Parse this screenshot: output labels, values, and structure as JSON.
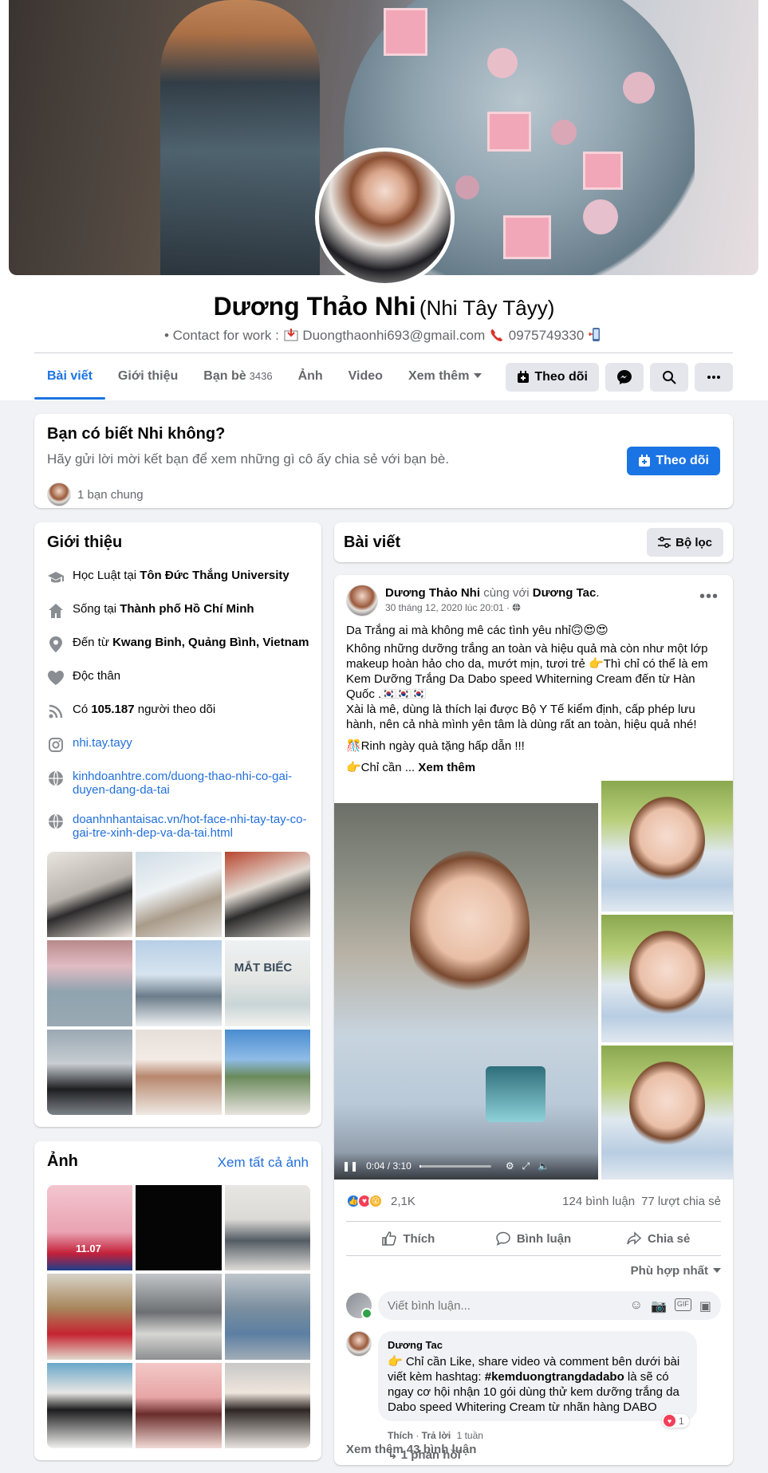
{
  "profile": {
    "name": "Dương Thảo Nhi",
    "alt_name": "(Nhi Tây Tâyy)",
    "contact_prefix": "• Contact for work :",
    "email": "Duongthaonhi693@gmail.com",
    "phone": "0975749330"
  },
  "tabs": [
    {
      "label": "Bài viết"
    },
    {
      "label": "Giới thiệu"
    },
    {
      "label": "Bạn bè",
      "count": "3436"
    },
    {
      "label": "Ảnh"
    },
    {
      "label": "Video"
    },
    {
      "label": "Xem thêm"
    }
  ],
  "actions": {
    "follow": "Theo dõi"
  },
  "know": {
    "title": "Bạn có biết Nhi không?",
    "subtitle": "Hãy gửi lời mời kết bạn để xem những gì cô ấy chia sẻ với bạn bè.",
    "mutual": "1 bạn chung",
    "follow": "Theo dõi"
  },
  "intro": {
    "title": "Giới thiệu",
    "study_prefix": "Học Luật tại ",
    "study_place": "Tôn Đức Thắng University",
    "live_prefix": "Sống tại ",
    "live_place": "Thành phố Hồ Chí Minh",
    "from_prefix": "Đến từ ",
    "from_place": "Kwang Binh, Quảng Bình, Vietnam",
    "relationship": "Độc thân",
    "followers_prefix": "Có ",
    "followers_count": "105.187",
    "followers_suffix": " người theo dõi",
    "instagram": "nhi.tay.tayy",
    "link1": "kinhdoanhtre.com/duong-thao-nhi-co-gai-duyen-dang-da-tai",
    "link2": "doanhnhantaisac.vn/hot-face-nhi-tay-tay-co-gai-tre-xinh-dep-va-da-tai.html",
    "photo_overlay_text": "MẮT BIẾC"
  },
  "photos": {
    "title": "Ảnh",
    "see_all": "Xem tất cả ảnh",
    "badge": "11.07"
  },
  "posts_header": {
    "title": "Bài viết",
    "filter": "Bộ lọc"
  },
  "post": {
    "author": "Dương Thảo Nhi",
    "with": "cùng với",
    "tagged": "Dương Tac",
    "date": "30 tháng 12, 2020 lúc 20:01 ·",
    "line1": "Da Trắng ai mà không mê các tình yêu nhỉ🙃😍😍",
    "line2": "Không những dưỡng trắng an toàn và hiệu quả mà còn như một lớp makeup hoàn hảo cho da, mướt mịn, tươi trẻ 👉Thì chỉ có thể là em Kem Dưỡng Trắng Da Dabo speed Whiterning Cream đến từ Hàn Quốc .🇰🇷🇰🇷🇰🇷",
    "line3": "Xài là mê, dùng là thích lại được Bộ Y Tế kiểm định, cấp phép lưu hành, nên cả nhà mình yên tâm là dùng rất an toàn, hiệu quả nhé!",
    "line4": "🎊Rinh ngày quà tặng hấp dẫn !!!",
    "line5": "👉Chỉ cần ...",
    "see_more": "Xem thêm",
    "video_time": "0:04 / 3:10",
    "reactions_count": "2,1K",
    "comments_count": "124 bình luận",
    "shares_count": "77 lượt chia sẻ",
    "like": "Thích",
    "comment": "Bình luận",
    "share": "Chia sẻ",
    "sort": "Phù hợp nhất",
    "comment_placeholder": "Viết bình luận..."
  },
  "comment": {
    "author": "Dương Tac",
    "text_before": "👉 Chỉ cần Like, share video và comment bên dưới bài viết kèm hashtag: ",
    "hashtag": "#kemduongtrangdadabo",
    "text_after": " là sẽ có ngay cơ hội nhận 10 gói dùng thử kem dưỡng trắng da Dabo speed Whitering Cream từ nhãn hàng DABO",
    "like_count": "1",
    "like_action": "Thích",
    "reply_action": "Trả lời",
    "time": "1 tuần",
    "replies": "1 phản hồi",
    "more_comments": "Xem thêm 43 bình luận"
  },
  "colors": {
    "accent": "#1b74e4",
    "link": "#216fdb",
    "bg": "#f0f2f5"
  }
}
